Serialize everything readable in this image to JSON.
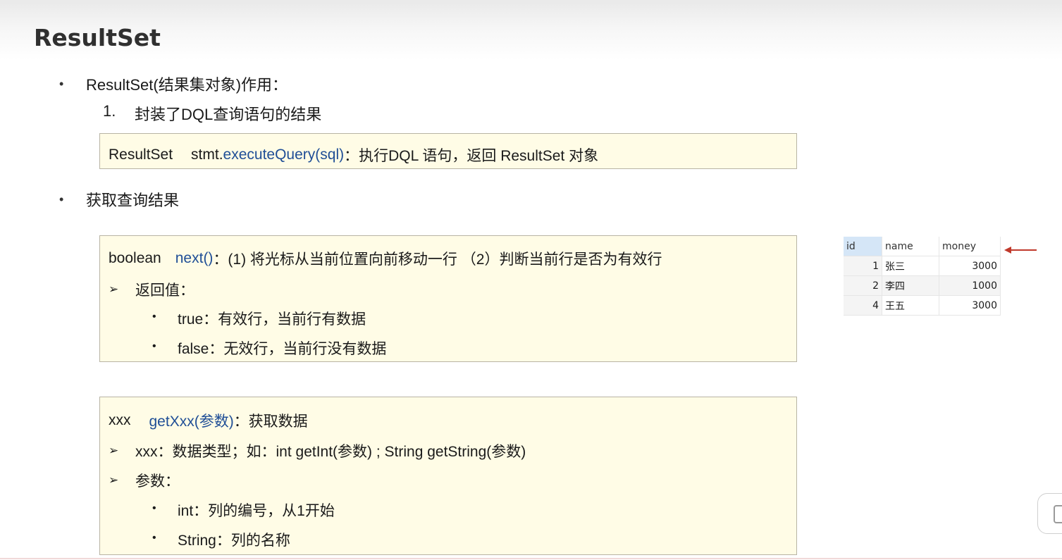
{
  "title": "ResultSet",
  "section1": {
    "bullet": "ResultSet(结果集对象)作用：",
    "item_num": "1.",
    "item_text": "封装了DQL查询语句的结果",
    "box": {
      "type": "ResultSet",
      "obj": "stmt.",
      "method": "executeQuery(sql)",
      "desc": "：执行DQL 语句，返回 ResultSet 对象"
    }
  },
  "section2": {
    "bullet": "获取查询结果",
    "next_box": {
      "type": "boolean",
      "method": "next()",
      "desc": "：(1) 将光标从当前位置向前移动一行 （2）判断当前行是否为有效行",
      "arrow": "➢",
      "return_label": "返回值：",
      "items": [
        "true：有效行，当前行有数据",
        "false：无效行，当前行没有数据"
      ]
    },
    "get_box": {
      "type": "xxx",
      "method": "getXxx(参数)",
      "desc": "：获取数据",
      "arrow": "➢",
      "line1": "xxx：数据类型；如：int getInt(参数) ; String getString(参数)",
      "line2": "参数：",
      "items": [
        "int：列的编号，从1开始",
        "String：列的名称"
      ]
    }
  },
  "bullet_symbol": "•",
  "result_table": {
    "headers": [
      "id",
      "name",
      "money"
    ],
    "rows": [
      [
        "1",
        "张三",
        "3000"
      ],
      [
        "2",
        "李四",
        "1000"
      ],
      [
        "4",
        "王五",
        "3000"
      ]
    ]
  },
  "colors": {
    "method": "#1f4e96",
    "box_bg": "#fffce6",
    "arrow": "#c0392b"
  }
}
